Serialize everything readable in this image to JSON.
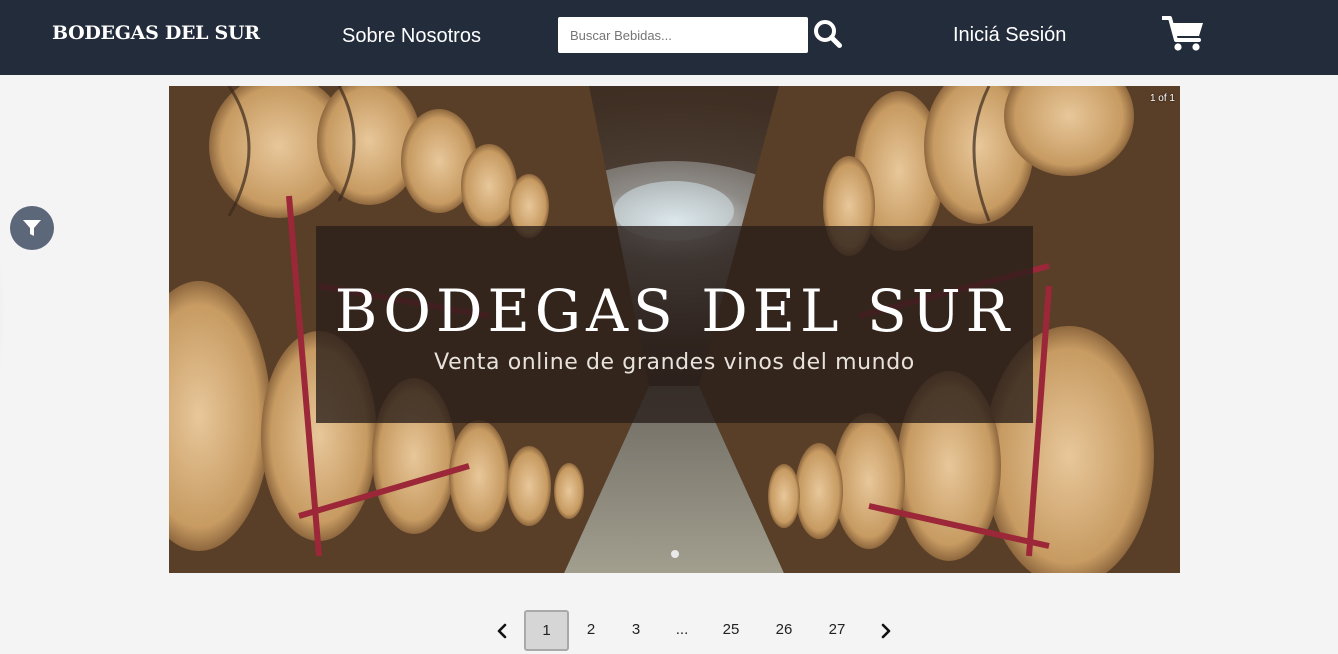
{
  "navbar": {
    "logo": "BODEGAS DEL SUR",
    "about_label": "Sobre Nosotros",
    "search_placeholder": "Buscar Bebidas...",
    "search_value": "",
    "login_label": "Iniciá Sesión",
    "search_icon": "search-icon",
    "cart_icon": "shopping-cart-icon",
    "bg_color": "#232c3b"
  },
  "filter": {
    "icon": "filter-icon",
    "color": "#5c6779"
  },
  "carousel": {
    "counter": "1 of 1",
    "banner_title": "BODEGAS DEL SUR",
    "banner_subtitle": "Venta online de grandes vinos del mundo",
    "slide_count": 1,
    "active_slide": 1
  },
  "pagination": {
    "prev_icon": "chevron-left-icon",
    "next_icon": "chevron-right-icon",
    "active": "1",
    "pages": [
      "2",
      "3",
      "...",
      "25",
      "26",
      "27"
    ]
  }
}
